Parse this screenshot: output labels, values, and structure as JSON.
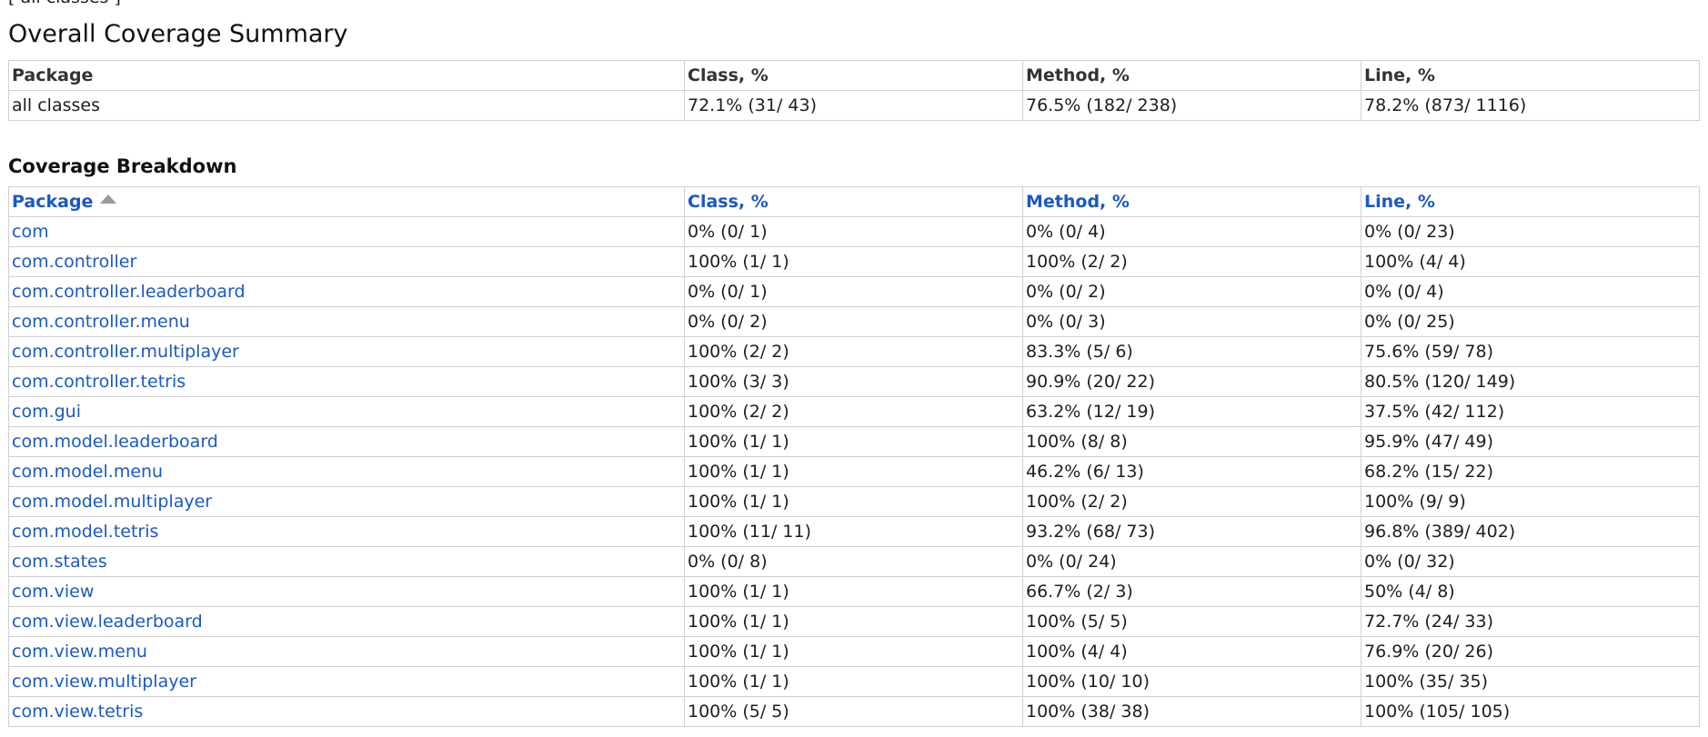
{
  "nav": {
    "all_classes_link": "[ all classes ]"
  },
  "page_title": "Overall Coverage Summary",
  "summary": {
    "headers": {
      "package": "Package",
      "class": "Class, %",
      "method": "Method, %",
      "line": "Line, %"
    },
    "row": {
      "package": "all classes",
      "class": "72.1% (31/ 43)",
      "method": "76.5% (182/ 238)",
      "line": "78.2% (873/ 1116)"
    }
  },
  "breakdown": {
    "title": "Coverage Breakdown",
    "sort_indicator_icon": "sort-ascending-triangle",
    "headers": {
      "package": "Package",
      "class": "Class, %",
      "method": "Method, %",
      "line": "Line, %"
    },
    "rows": [
      {
        "package": "com",
        "class": "0% (0/ 1)",
        "method": "0% (0/ 4)",
        "line": "0% (0/ 23)"
      },
      {
        "package": "com.controller",
        "class": "100% (1/ 1)",
        "method": "100% (2/ 2)",
        "line": "100% (4/ 4)"
      },
      {
        "package": "com.controller.leaderboard",
        "class": "0% (0/ 1)",
        "method": "0% (0/ 2)",
        "line": "0% (0/ 4)"
      },
      {
        "package": "com.controller.menu",
        "class": "0% (0/ 2)",
        "method": "0% (0/ 3)",
        "line": "0% (0/ 25)"
      },
      {
        "package": "com.controller.multiplayer",
        "class": "100% (2/ 2)",
        "method": "83.3% (5/ 6)",
        "line": "75.6% (59/ 78)"
      },
      {
        "package": "com.controller.tetris",
        "class": "100% (3/ 3)",
        "method": "90.9% (20/ 22)",
        "line": "80.5% (120/ 149)"
      },
      {
        "package": "com.gui",
        "class": "100% (2/ 2)",
        "method": "63.2% (12/ 19)",
        "line": "37.5% (42/ 112)"
      },
      {
        "package": "com.model.leaderboard",
        "class": "100% (1/ 1)",
        "method": "100% (8/ 8)",
        "line": "95.9% (47/ 49)"
      },
      {
        "package": "com.model.menu",
        "class": "100% (1/ 1)",
        "method": "46.2% (6/ 13)",
        "line": "68.2% (15/ 22)"
      },
      {
        "package": "com.model.multiplayer",
        "class": "100% (1/ 1)",
        "method": "100% (2/ 2)",
        "line": "100% (9/ 9)"
      },
      {
        "package": "com.model.tetris",
        "class": "100% (11/ 11)",
        "method": "93.2% (68/ 73)",
        "line": "96.8% (389/ 402)"
      },
      {
        "package": "com.states",
        "class": "0% (0/ 8)",
        "method": "0% (0/ 24)",
        "line": "0% (0/ 32)"
      },
      {
        "package": "com.view",
        "class": "100% (1/ 1)",
        "method": "66.7% (2/ 3)",
        "line": "50% (4/ 8)"
      },
      {
        "package": "com.view.leaderboard",
        "class": "100% (1/ 1)",
        "method": "100% (5/ 5)",
        "line": "72.7% (24/ 33)"
      },
      {
        "package": "com.view.menu",
        "class": "100% (1/ 1)",
        "method": "100% (4/ 4)",
        "line": "76.9% (20/ 26)"
      },
      {
        "package": "com.view.multiplayer",
        "class": "100% (1/ 1)",
        "method": "100% (10/ 10)",
        "line": "100% (35/ 35)"
      },
      {
        "package": "com.view.tetris",
        "class": "100% (5/ 5)",
        "method": "100% (38/ 38)",
        "line": "100% (105/ 105)"
      }
    ]
  },
  "colors": {
    "link": "#1a58c7",
    "border": "#d0d0d0",
    "text": "#1e1e1e"
  }
}
